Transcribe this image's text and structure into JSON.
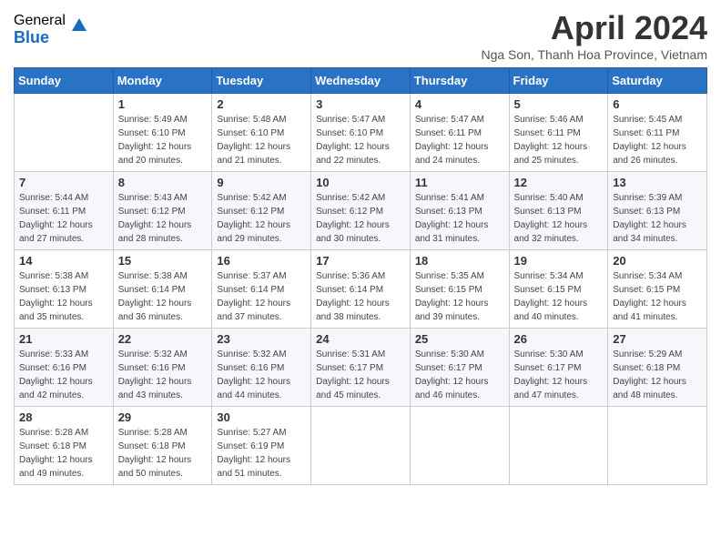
{
  "logo": {
    "general": "General",
    "blue": "Blue"
  },
  "header": {
    "title": "April 2024",
    "subtitle": "Nga Son, Thanh Hoa Province, Vietnam"
  },
  "days_of_week": [
    "Sunday",
    "Monday",
    "Tuesday",
    "Wednesday",
    "Thursday",
    "Friday",
    "Saturday"
  ],
  "weeks": [
    [
      {
        "day": "",
        "info": ""
      },
      {
        "day": "1",
        "info": "Sunrise: 5:49 AM\nSunset: 6:10 PM\nDaylight: 12 hours\nand 20 minutes."
      },
      {
        "day": "2",
        "info": "Sunrise: 5:48 AM\nSunset: 6:10 PM\nDaylight: 12 hours\nand 21 minutes."
      },
      {
        "day": "3",
        "info": "Sunrise: 5:47 AM\nSunset: 6:10 PM\nDaylight: 12 hours\nand 22 minutes."
      },
      {
        "day": "4",
        "info": "Sunrise: 5:47 AM\nSunset: 6:11 PM\nDaylight: 12 hours\nand 24 minutes."
      },
      {
        "day": "5",
        "info": "Sunrise: 5:46 AM\nSunset: 6:11 PM\nDaylight: 12 hours\nand 25 minutes."
      },
      {
        "day": "6",
        "info": "Sunrise: 5:45 AM\nSunset: 6:11 PM\nDaylight: 12 hours\nand 26 minutes."
      }
    ],
    [
      {
        "day": "7",
        "info": "Sunrise: 5:44 AM\nSunset: 6:11 PM\nDaylight: 12 hours\nand 27 minutes."
      },
      {
        "day": "8",
        "info": "Sunrise: 5:43 AM\nSunset: 6:12 PM\nDaylight: 12 hours\nand 28 minutes."
      },
      {
        "day": "9",
        "info": "Sunrise: 5:42 AM\nSunset: 6:12 PM\nDaylight: 12 hours\nand 29 minutes."
      },
      {
        "day": "10",
        "info": "Sunrise: 5:42 AM\nSunset: 6:12 PM\nDaylight: 12 hours\nand 30 minutes."
      },
      {
        "day": "11",
        "info": "Sunrise: 5:41 AM\nSunset: 6:13 PM\nDaylight: 12 hours\nand 31 minutes."
      },
      {
        "day": "12",
        "info": "Sunrise: 5:40 AM\nSunset: 6:13 PM\nDaylight: 12 hours\nand 32 minutes."
      },
      {
        "day": "13",
        "info": "Sunrise: 5:39 AM\nSunset: 6:13 PM\nDaylight: 12 hours\nand 34 minutes."
      }
    ],
    [
      {
        "day": "14",
        "info": "Sunrise: 5:38 AM\nSunset: 6:13 PM\nDaylight: 12 hours\nand 35 minutes."
      },
      {
        "day": "15",
        "info": "Sunrise: 5:38 AM\nSunset: 6:14 PM\nDaylight: 12 hours\nand 36 minutes."
      },
      {
        "day": "16",
        "info": "Sunrise: 5:37 AM\nSunset: 6:14 PM\nDaylight: 12 hours\nand 37 minutes."
      },
      {
        "day": "17",
        "info": "Sunrise: 5:36 AM\nSunset: 6:14 PM\nDaylight: 12 hours\nand 38 minutes."
      },
      {
        "day": "18",
        "info": "Sunrise: 5:35 AM\nSunset: 6:15 PM\nDaylight: 12 hours\nand 39 minutes."
      },
      {
        "day": "19",
        "info": "Sunrise: 5:34 AM\nSunset: 6:15 PM\nDaylight: 12 hours\nand 40 minutes."
      },
      {
        "day": "20",
        "info": "Sunrise: 5:34 AM\nSunset: 6:15 PM\nDaylight: 12 hours\nand 41 minutes."
      }
    ],
    [
      {
        "day": "21",
        "info": "Sunrise: 5:33 AM\nSunset: 6:16 PM\nDaylight: 12 hours\nand 42 minutes."
      },
      {
        "day": "22",
        "info": "Sunrise: 5:32 AM\nSunset: 6:16 PM\nDaylight: 12 hours\nand 43 minutes."
      },
      {
        "day": "23",
        "info": "Sunrise: 5:32 AM\nSunset: 6:16 PM\nDaylight: 12 hours\nand 44 minutes."
      },
      {
        "day": "24",
        "info": "Sunrise: 5:31 AM\nSunset: 6:17 PM\nDaylight: 12 hours\nand 45 minutes."
      },
      {
        "day": "25",
        "info": "Sunrise: 5:30 AM\nSunset: 6:17 PM\nDaylight: 12 hours\nand 46 minutes."
      },
      {
        "day": "26",
        "info": "Sunrise: 5:30 AM\nSunset: 6:17 PM\nDaylight: 12 hours\nand 47 minutes."
      },
      {
        "day": "27",
        "info": "Sunrise: 5:29 AM\nSunset: 6:18 PM\nDaylight: 12 hours\nand 48 minutes."
      }
    ],
    [
      {
        "day": "28",
        "info": "Sunrise: 5:28 AM\nSunset: 6:18 PM\nDaylight: 12 hours\nand 49 minutes."
      },
      {
        "day": "29",
        "info": "Sunrise: 5:28 AM\nSunset: 6:18 PM\nDaylight: 12 hours\nand 50 minutes."
      },
      {
        "day": "30",
        "info": "Sunrise: 5:27 AM\nSunset: 6:19 PM\nDaylight: 12 hours\nand 51 minutes."
      },
      {
        "day": "",
        "info": ""
      },
      {
        "day": "",
        "info": ""
      },
      {
        "day": "",
        "info": ""
      },
      {
        "day": "",
        "info": ""
      }
    ]
  ]
}
